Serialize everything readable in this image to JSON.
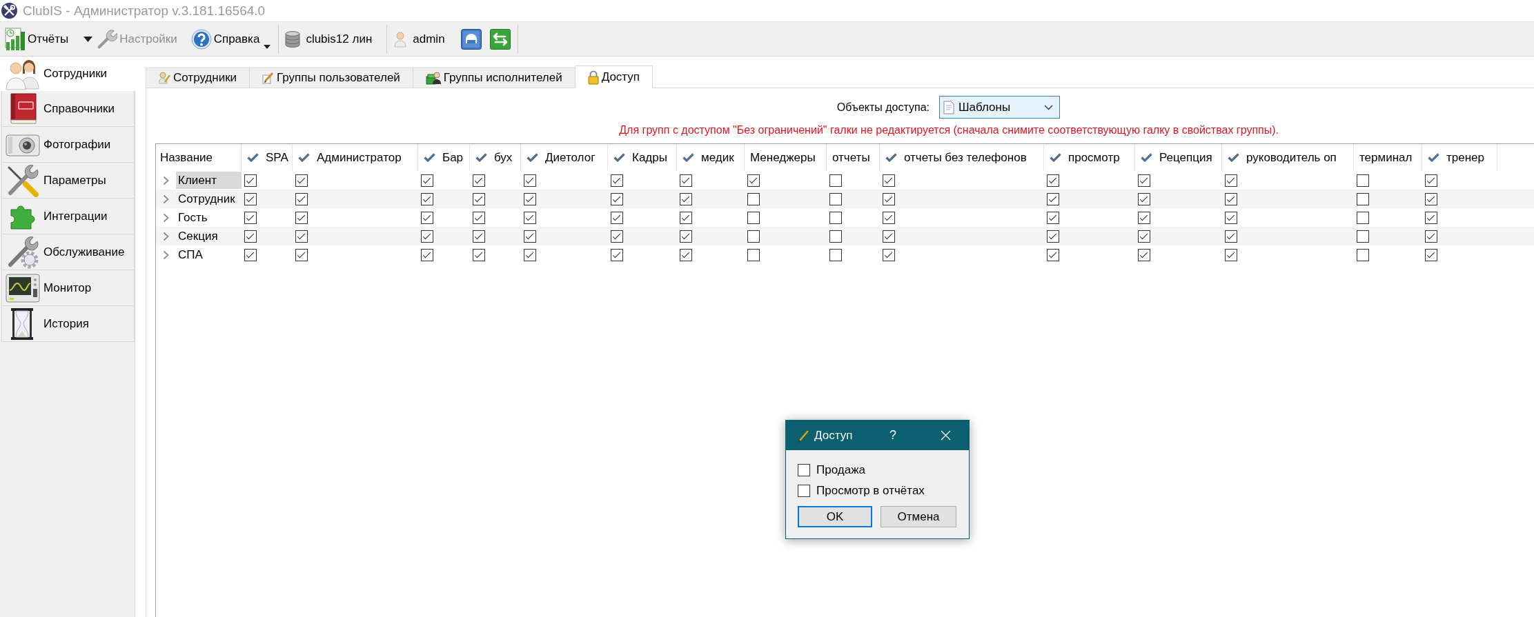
{
  "window": {
    "title": "ClubIS - Администратор v.3.181.16564.0"
  },
  "toolbar": [
    {
      "kind": "split",
      "label": "Отчёты",
      "disabled": false
    },
    {
      "kind": "plain",
      "label": "Настройки",
      "disabled": true
    },
    {
      "kind": "menu",
      "label": "Справка",
      "disabled": false
    },
    {
      "kind": "separator"
    },
    {
      "kind": "plain",
      "label": "clubis12 лин",
      "disabled": false
    },
    {
      "kind": "separator"
    },
    {
      "kind": "plain",
      "label": "admin",
      "disabled": false
    },
    {
      "kind": "icon",
      "disabled": false
    },
    {
      "kind": "icon",
      "disabled": false
    },
    {
      "kind": "separator"
    }
  ],
  "sidebar": {
    "items": [
      {
        "label": "Сотрудники",
        "selected": true
      },
      {
        "label": "Справочники",
        "selected": false
      },
      {
        "label": "Фотографии",
        "selected": false
      },
      {
        "label": "Параметры",
        "selected": false
      },
      {
        "label": "Интеграции",
        "selected": false
      },
      {
        "label": "Обслуживание",
        "selected": false
      },
      {
        "label": "Монитор",
        "selected": false
      },
      {
        "label": "История",
        "selected": false
      }
    ]
  },
  "tabs": [
    {
      "label": "Сотрудники",
      "selected": false
    },
    {
      "label": "Группы пользователей",
      "selected": false
    },
    {
      "label": "Группы исполнителей",
      "selected": false
    },
    {
      "label": "Доступ",
      "selected": true
    }
  ],
  "access_objects": {
    "label": "Объекты доступа:",
    "value": "Шаблоны"
  },
  "warning": "Для групп с доступом \"Без ограничений\" галки не редактируется (сначала снимите соответствующую галку в свойствах группы).",
  "table": {
    "name_column": "Название",
    "columns": [
      {
        "label": "SPA",
        "checked": true
      },
      {
        "label": "Администратор",
        "checked": true
      },
      {
        "label": "Бар",
        "checked": true
      },
      {
        "label": "бух",
        "checked": true
      },
      {
        "label": "Диетолог",
        "checked": true
      },
      {
        "label": "Кадры",
        "checked": true
      },
      {
        "label": "медик",
        "checked": true
      },
      {
        "label": "Менеджеры",
        "checked": false
      },
      {
        "label": "отчеты",
        "checked": false
      },
      {
        "label": "отчеты без телефонов",
        "checked": true
      },
      {
        "label": "просмотр",
        "checked": true
      },
      {
        "label": "Рецепция",
        "checked": true
      },
      {
        "label": "руководитель оп",
        "checked": true
      },
      {
        "label": "терминал",
        "checked": false
      },
      {
        "label": "тренер",
        "checked": true
      }
    ],
    "rows": [
      {
        "name": "Клиент",
        "selected": true,
        "expanded": false,
        "checks": [
          true,
          true,
          true,
          true,
          true,
          true,
          true,
          true,
          false,
          true,
          true,
          true,
          true,
          false,
          true
        ]
      },
      {
        "name": "Сотрудник",
        "selected": false,
        "expanded": false,
        "checks": [
          true,
          true,
          true,
          true,
          true,
          true,
          true,
          false,
          false,
          true,
          true,
          true,
          true,
          false,
          true
        ]
      },
      {
        "name": "Гость",
        "selected": false,
        "expanded": false,
        "checks": [
          true,
          true,
          true,
          true,
          true,
          true,
          true,
          false,
          false,
          true,
          true,
          true,
          true,
          false,
          true
        ]
      },
      {
        "name": "Секция",
        "selected": false,
        "expanded": false,
        "checks": [
          true,
          true,
          true,
          true,
          true,
          true,
          true,
          false,
          false,
          true,
          true,
          true,
          true,
          false,
          true
        ]
      },
      {
        "name": "СПА",
        "selected": false,
        "expanded": false,
        "checks": [
          true,
          true,
          true,
          true,
          true,
          true,
          true,
          false,
          false,
          true,
          true,
          true,
          true,
          false,
          true
        ]
      }
    ]
  },
  "dialog": {
    "title": "Доступ",
    "help": "?",
    "options": [
      {
        "label": "Продажа",
        "checked": false
      },
      {
        "label": "Просмотр в отчётах",
        "checked": false
      }
    ],
    "buttons": [
      {
        "label": "OK",
        "default": true
      },
      {
        "label": "Отмена",
        "default": false
      }
    ]
  }
}
